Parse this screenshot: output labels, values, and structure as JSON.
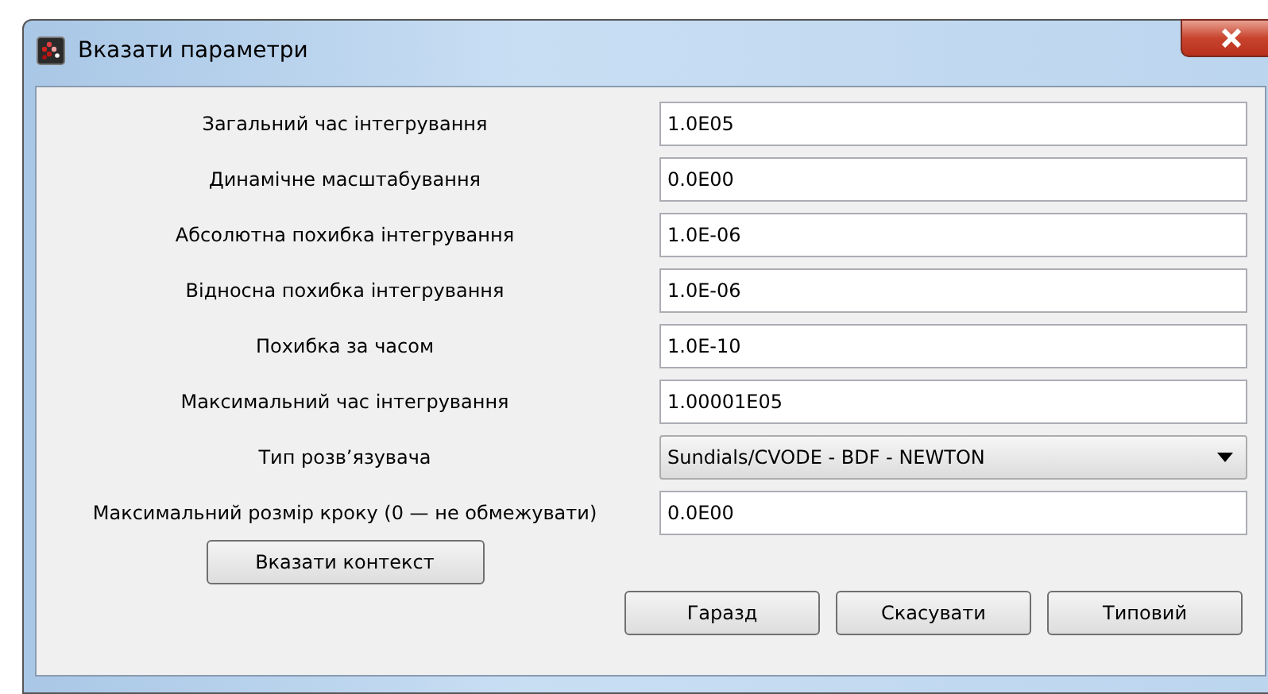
{
  "window": {
    "title": "Вказати параметри"
  },
  "fields": [
    {
      "kind": "text",
      "label": "Загальний час інтегрування",
      "value": "1.0E05"
    },
    {
      "kind": "text",
      "label": "Динамічне масштабування",
      "value": "0.0E00"
    },
    {
      "kind": "text",
      "label": "Абсолютна похибка інтегрування",
      "value": "1.0E-06"
    },
    {
      "kind": "text",
      "label": "Відносна похибка інтегрування",
      "value": "1.0E-06"
    },
    {
      "kind": "text",
      "label": "Похибка за часом",
      "value": "1.0E-10"
    },
    {
      "kind": "text",
      "label": "Максимальний час інтегрування",
      "value": "1.00001E05"
    },
    {
      "kind": "dropdown",
      "label": "Тип розв’язувача",
      "value": "Sundials/CVODE - BDF - NEWTON"
    },
    {
      "kind": "text",
      "label": "Максимальний розмір кроку (0 — не обмежувати)",
      "value": "0.0E00"
    }
  ],
  "context_button": "Вказати контекст",
  "buttons": [
    "Гаразд",
    "Скасувати",
    "Типовий"
  ]
}
